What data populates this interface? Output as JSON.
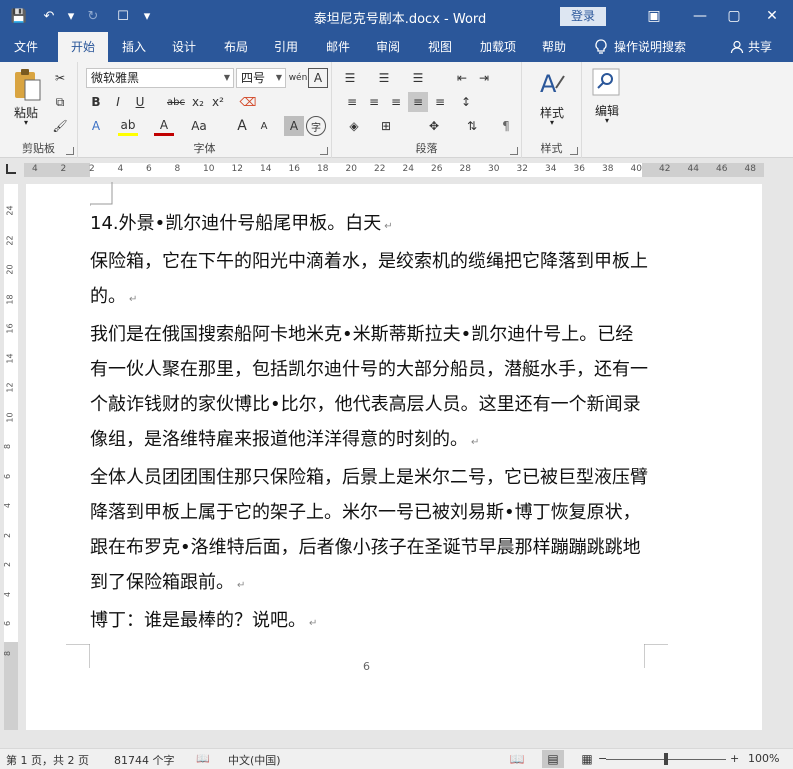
{
  "window": {
    "title": "泰坦尼克号剧本.docx  -  Word",
    "login_label": "登录",
    "minimize_label": "—",
    "restore_label": "▢",
    "close_label": "✕",
    "restore_ribbon_label": "▣"
  },
  "quick_access": {
    "save": "💾",
    "undo": "↶",
    "undo_dd": "▾",
    "redo": "↻",
    "touch": "☐",
    "customize": "▾"
  },
  "tabs": [
    {
      "label": "文件"
    },
    {
      "label": "开始",
      "active": true
    },
    {
      "label": "插入"
    },
    {
      "label": "设计"
    },
    {
      "label": "布局"
    },
    {
      "label": "引用"
    },
    {
      "label": "邮件"
    },
    {
      "label": "审阅"
    },
    {
      "label": "视图"
    },
    {
      "label": "加载项"
    },
    {
      "label": "帮助"
    }
  ],
  "tell_me": {
    "label": "操作说明搜索",
    "icon": "lightbulb-icon"
  },
  "share": {
    "label": "共享",
    "icon": "person-icon"
  },
  "ribbon": {
    "clipboard": {
      "label": "剪贴板",
      "paste_label": "粘贴"
    },
    "font": {
      "label": "字体",
      "font_name": "微软雅黑",
      "font_size": "四号",
      "bold": "B",
      "italic": "I",
      "underline": "U",
      "strikethrough": "abc",
      "subscript": "x₂",
      "superscript": "x²",
      "grow": "A",
      "shrink": "A",
      "change_case": "Aa",
      "char_shading": "A",
      "enclose": "字",
      "phonetic": "wén",
      "char_border": "A",
      "text_effects": "A",
      "font_color": "A"
    },
    "paragraph": {
      "label": "段落"
    },
    "styles": {
      "label": "样式",
      "button_label": "样式"
    },
    "editing": {
      "label": "编辑"
    }
  },
  "ruler": {
    "numbers": [
      "4",
      "2",
      "2",
      "4",
      "6",
      "8",
      "10",
      "12",
      "14",
      "16",
      "18",
      "20",
      "22",
      "24",
      "26",
      "28",
      "30",
      "32",
      "34",
      "36",
      "38",
      "40",
      "42",
      "44",
      "46",
      "48"
    ],
    "vertical_numbers": [
      "24",
      "22",
      "20",
      "18",
      "16",
      "14",
      "12",
      "10",
      "8",
      "6",
      "4",
      "2",
      "2",
      "4",
      "6",
      "8"
    ]
  },
  "document": {
    "paragraphs": [
      "14.外景•凯尔迪什号船尾甲板。白天",
      "保险箱，它在下午的阳光中滴着水，是绞索机的缆绳把它降落到甲板上的。",
      "我们是在俄国搜索船阿卡地米克•米斯蒂斯拉夫•凯尔迪什号上。已经有一伙人聚在那里，包括凯尔迪什号的大部分船员，潜艇水手，还有一个敲诈钱财的家伙博比•比尔，他代表高层人员。这里还有一个新闻录像组，是洛维特雇来报道他洋洋得意的时刻的。",
      "全体人员团团围住那只保险箱，后景上是米尔二号，它已被巨型液压臂降落到甲板上属于它的架子上。米尔一号已被刘易斯•博丁恢复原状，跟在布罗克•洛维特后面，后者像小孩子在圣诞节早晨那样蹦蹦跳跳地到了保险箱跟前。",
      "博丁：谁是最棒的？说吧。"
    ],
    "paragraph_mark": "↵",
    "page_number": "6"
  },
  "statusbar": {
    "page_info": "第 1 页，共 2 页",
    "word_count": "81744 个字",
    "language": "中文(中国)",
    "zoom_minus": "−",
    "zoom_plus": "+",
    "zoom_level": "100%",
    "zoom_fraction": 0.5
  },
  "colors": {
    "brand": "#2b579a"
  }
}
